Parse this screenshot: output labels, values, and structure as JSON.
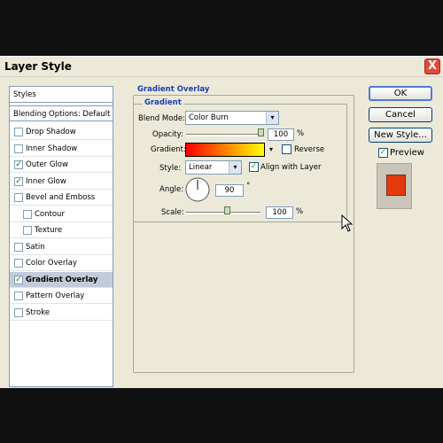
{
  "window": {
    "title": "Layer Style",
    "close_glyph": "X"
  },
  "sidebar": {
    "header": "Styles",
    "blending": "Blending Options: Default",
    "items": [
      {
        "label": "Drop Shadow",
        "checked": false,
        "indent": false,
        "selected": false
      },
      {
        "label": "Inner Shadow",
        "checked": false,
        "indent": false,
        "selected": false
      },
      {
        "label": "Outer Glow",
        "checked": true,
        "indent": false,
        "selected": false
      },
      {
        "label": "Inner Glow",
        "checked": true,
        "indent": false,
        "selected": false
      },
      {
        "label": "Bevel and Emboss",
        "checked": false,
        "indent": false,
        "selected": false
      },
      {
        "label": "Contour",
        "checked": false,
        "indent": true,
        "selected": false
      },
      {
        "label": "Texture",
        "checked": false,
        "indent": true,
        "selected": false
      },
      {
        "label": "Satin",
        "checked": false,
        "indent": false,
        "selected": false
      },
      {
        "label": "Color Overlay",
        "checked": false,
        "indent": false,
        "selected": false
      },
      {
        "label": "Gradient Overlay",
        "checked": true,
        "indent": false,
        "selected": true
      },
      {
        "label": "Pattern Overlay",
        "checked": false,
        "indent": false,
        "selected": false
      },
      {
        "label": "Stroke",
        "checked": false,
        "indent": false,
        "selected": false
      }
    ]
  },
  "panel": {
    "group_title": "Gradient Overlay",
    "subgroup_title": "Gradient",
    "blend_mode_label": "Blend Mode:",
    "blend_mode_value": "Color Burn",
    "opacity_label": "Opacity:",
    "opacity_value": "100",
    "opacity_level": 1.0,
    "percent": "%",
    "gradient_label": "Gradient:",
    "gradient_colors": [
      "#ff0000",
      "#ffff00"
    ],
    "reverse_label": "Reverse",
    "reverse_checked": false,
    "style_label": "Style:",
    "style_value": "Linear",
    "align_label": "Align with Layer",
    "align_checked": true,
    "angle_label": "Angle:",
    "angle_value": "90",
    "degree": "°",
    "scale_label": "Scale:",
    "scale_value": "100",
    "scale_level": 0.55
  },
  "buttons": {
    "ok": "OK",
    "cancel": "Cancel",
    "new_style": "New Style...",
    "preview_label": "Preview",
    "preview_checked": true,
    "preview_color": "#e33b0e"
  },
  "colors": {
    "accent": "#1a3fb0",
    "selection": "#c3cbda",
    "dialog_bg": "#ece9d8"
  },
  "icons": {
    "check": "✓",
    "dropdown": "▾",
    "pointer": "cursor-arrow-icon"
  }
}
